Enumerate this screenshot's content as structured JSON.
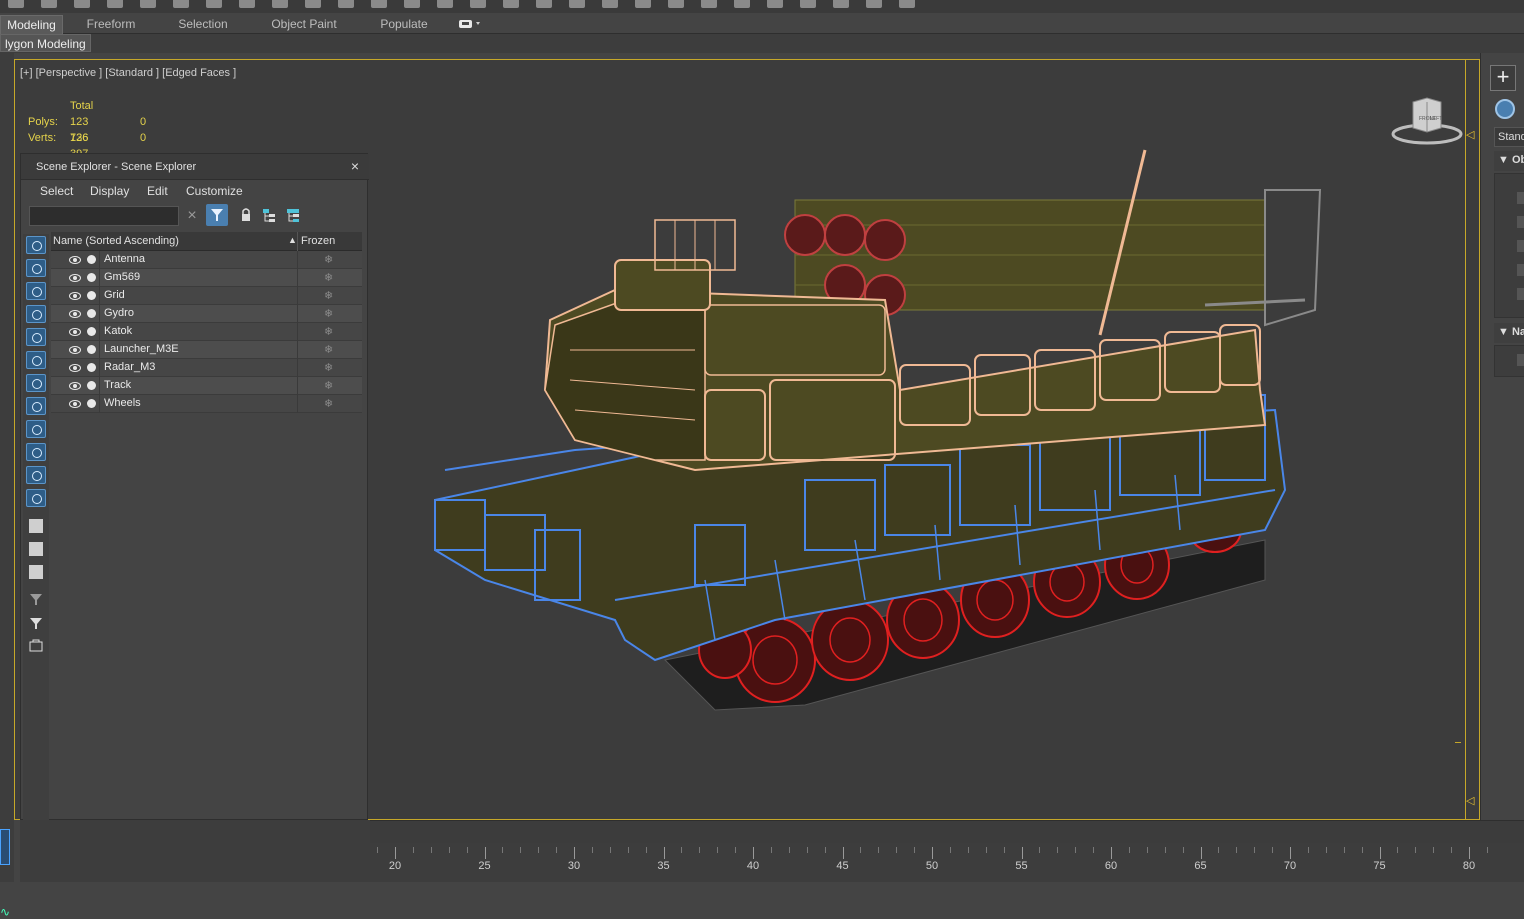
{
  "toolbar": {
    "icons": [
      "toolbar-icon",
      "toolbar-icon",
      "toolbar-icon",
      "toolbar-icon",
      "toolbar-icon",
      "toolbar-icon",
      "toolbar-icon",
      "toolbar-icon",
      "toolbar-icon",
      "toolbar-icon",
      "toolbar-icon",
      "toolbar-icon",
      "toolbar-icon",
      "toolbar-icon",
      "toolbar-icon",
      "toolbar-icon",
      "toolbar-icon",
      "toolbar-icon",
      "toolbar-icon",
      "toolbar-icon",
      "toolbar-icon",
      "toolbar-icon",
      "toolbar-icon",
      "toolbar-icon",
      "toolbar-icon",
      "toolbar-icon",
      "toolbar-icon",
      "toolbar-icon"
    ]
  },
  "ribbon": {
    "tabs": [
      "Modeling",
      "Freeform",
      "Selection",
      "Object Paint",
      "Populate"
    ],
    "active_tab": "Modeling",
    "subtab": "lygon Modeling"
  },
  "viewport": {
    "label": "[+] [Perspective ] [Standard ] [Edged Faces ]",
    "stats": {
      "header": "Total",
      "polys_label": "Polys:",
      "polys_total": "123 736",
      "polys_sel": "0",
      "verts_label": "Verts:",
      "verts_total": "126 397",
      "verts_sel": "0"
    },
    "viewcube_labels": [
      "FRONT",
      "LEFT"
    ],
    "colors": {
      "frame": "#c6a829",
      "antenna_launcher": "#f0b994",
      "hull": "#4a86e8",
      "wheels": "#e02020",
      "body": "#4d4a22"
    }
  },
  "explorer": {
    "title": "Scene Explorer - Scene Explorer",
    "menu": [
      "Select",
      "Display",
      "Edit",
      "Customize"
    ],
    "search_placeholder": "",
    "columns": {
      "name": "Name (Sorted Ascending)",
      "sort_arrow": "▲",
      "frozen": "Frozen"
    },
    "objects": [
      "Antenna",
      "Gm569",
      "Grid",
      "Gydro",
      "Katok",
      "Launcher_M3E",
      "Radar_M3",
      "Track",
      "Wheels"
    ],
    "frozen_glyph": "❄",
    "close_glyph": "×",
    "clear_glyph": "×"
  },
  "right_panel": {
    "dropdown": "Standard",
    "rollouts": [
      "Ob",
      "Na"
    ],
    "plus": "+"
  },
  "timeline": {
    "labels": [
      "20",
      "25",
      "30",
      "35",
      "40",
      "45",
      "50",
      "55",
      "60",
      "65",
      "70",
      "75",
      "80"
    ]
  }
}
